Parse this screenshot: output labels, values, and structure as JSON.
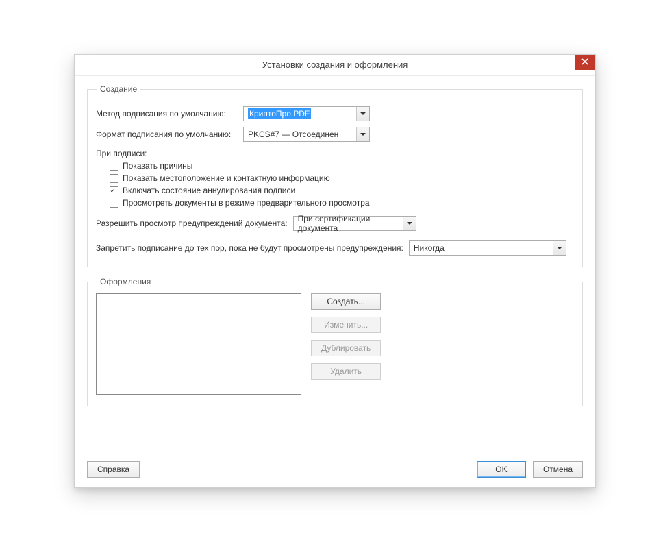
{
  "window": {
    "title": "Установки создания и оформления"
  },
  "creation": {
    "legend": "Создание",
    "method_label": "Метод подписания по умолчанию:",
    "method_value": "КриптоПро PDF",
    "format_label": "Формат подписания по умолчанию:",
    "format_value": "PKCS#7 — Отсоединен",
    "when_signing_label": "При подписи:",
    "checks": [
      {
        "label": "Показать причины",
        "checked": false
      },
      {
        "label": "Показать местоположение и контактную информацию",
        "checked": false
      },
      {
        "label": "Включать состояние аннулирования подписи",
        "checked": true
      },
      {
        "label": "Просмотреть документы в режиме предварительного просмотра",
        "checked": false
      }
    ],
    "allow_warnings_label": "Разрешить просмотр предупреждений документа:",
    "allow_warnings_value": "При сертификации документа",
    "prevent_until_label": "Запретить подписание до тех пор, пока не будут просмотрены предупреждения:",
    "prevent_until_value": "Никогда"
  },
  "appearances": {
    "legend": "Оформления",
    "buttons": {
      "create": "Создать...",
      "edit": "Изменить...",
      "duplicate": "Дублировать",
      "delete": "Удалить"
    }
  },
  "footer": {
    "help": "Справка",
    "ok": "OK",
    "cancel": "Отмена"
  }
}
